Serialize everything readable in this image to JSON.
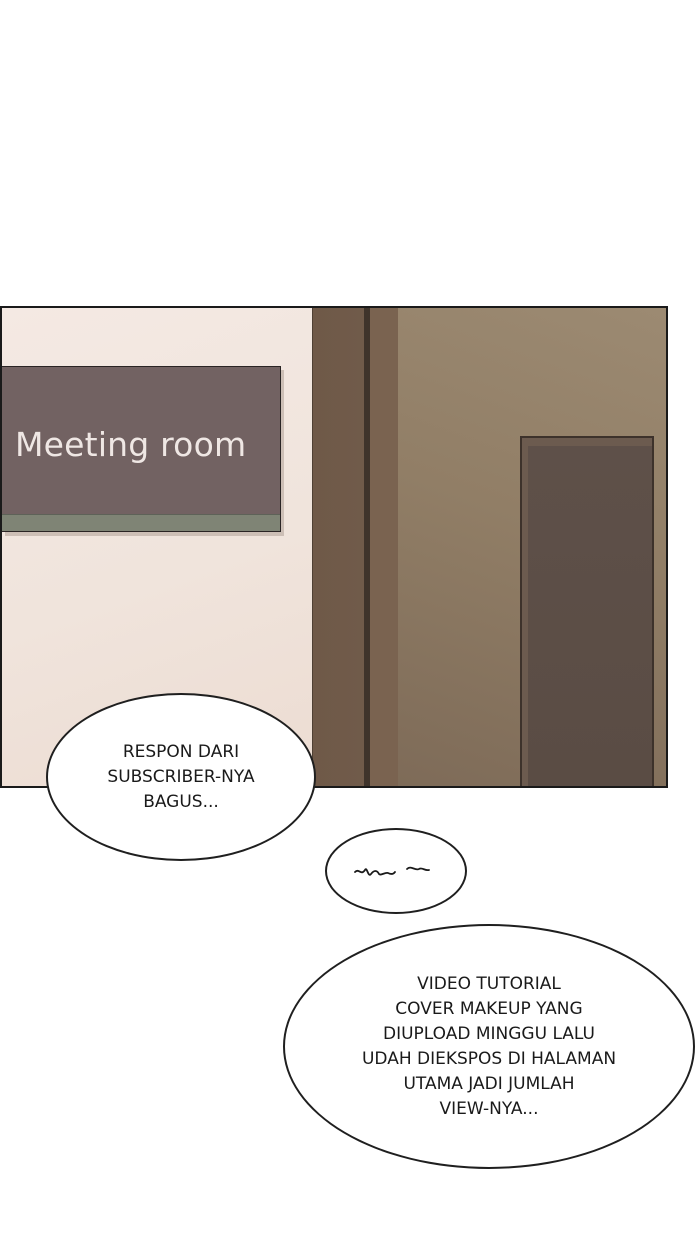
{
  "panel": {
    "sign_text": "Meeting room"
  },
  "bubbles": {
    "first": "RESPON DARI\nSUBSCRIBER-NYA\nBAGUS...",
    "second_icon": "mumble-scribble",
    "third": "VIDEO TUTORIAL\nCOVER MAKEUP YANG\nDIUPLOAD MINGGU LALU\nUDAH DIEKSPOS DI HALAMAN\nUTAMA JADI JUMLAH\nVIEW-NYA..."
  },
  "colors": {
    "sign": "#726262",
    "wall_left": "#f4e9e3",
    "wall_right": "#917e66",
    "door": "#5e5049"
  }
}
